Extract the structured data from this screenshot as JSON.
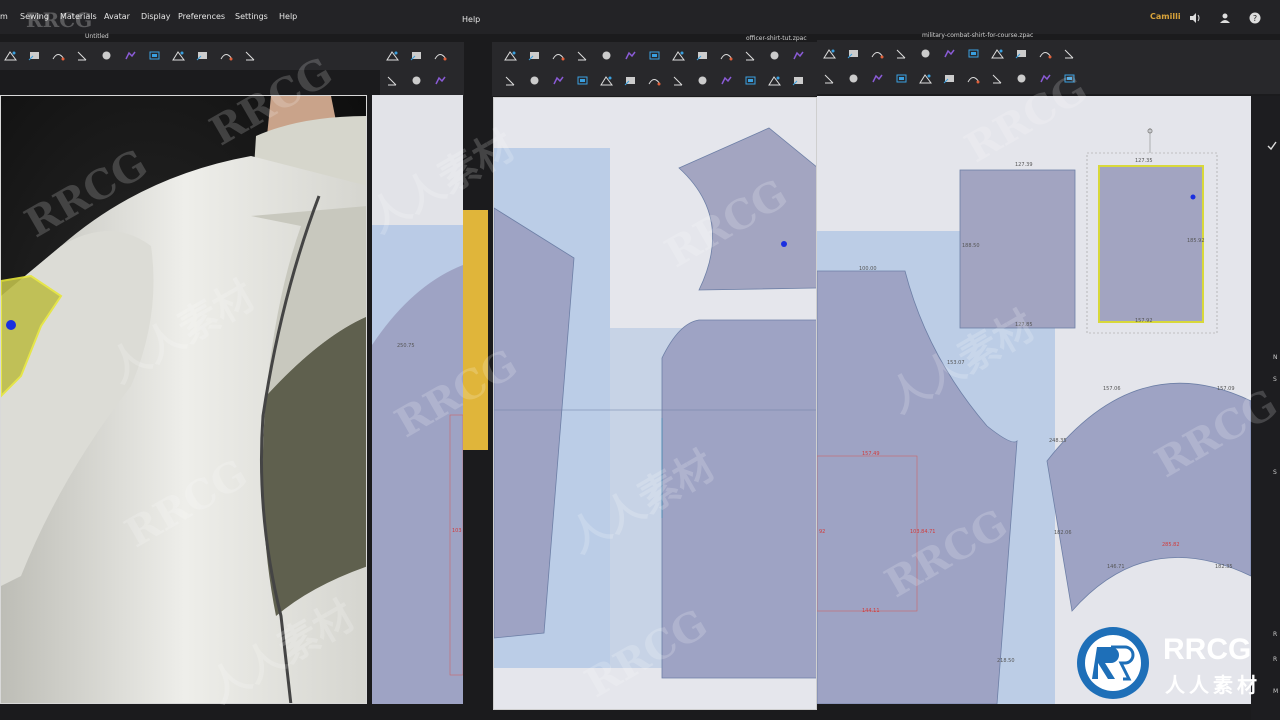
{
  "menu": {
    "items": [
      "m",
      "Sewing",
      "Materials",
      "Avatar",
      "Display",
      "Preferences",
      "Settings",
      "Help"
    ],
    "help_right": "Help"
  },
  "documents": {
    "left_title": "Untitled",
    "middle_title": "officer-shirt-tut.zpac",
    "right_title": "military-combat-shirt-for-course.zpac"
  },
  "user": {
    "name": "Camilli"
  },
  "measurements": {
    "m1": "250.75",
    "m2": "153.07",
    "m3": "100.00",
    "m4": "157.49",
    "m5": "127.39",
    "m6": "127.85",
    "m7": "188.50",
    "m8": "185.92",
    "m9": "127.35",
    "m10": "182.35",
    "m11": "157.06",
    "m12": "182.06",
    "m13": "146.71",
    "m14": "157.09",
    "m15": "248.35",
    "m16": "103.84.71",
    "m17": "144.11",
    "m18": "218.50",
    "m19": "285.82",
    "m20": "157.92",
    "m21": "92",
    "m22": "103"
  },
  "side_letters": [
    "N",
    "S",
    "S",
    "R",
    "R",
    "M"
  ],
  "watermarks": {
    "brand": "RRCG",
    "cn": "人人素材"
  },
  "logo": {
    "title": "RRCG",
    "subtitle": "人人素材"
  },
  "colors": {
    "pattern_fill": "#9ea3c4",
    "selected_outline": "#d8d83a",
    "grid_blue": "#b9cbe6",
    "panel_bg": "#e3e4ea",
    "accent_purple": "#8a5bd6"
  }
}
